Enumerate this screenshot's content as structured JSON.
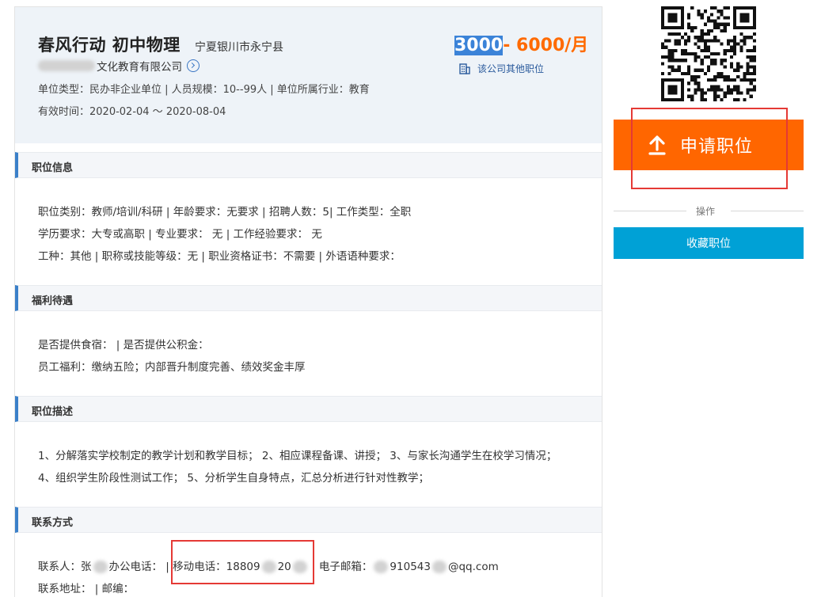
{
  "header": {
    "title": "春风行动 初中物理",
    "location": "宁夏银川市永宁县",
    "salary_selected": "3000",
    "salary_rest": "- 6000/月",
    "company_visible": "文化教育有限公司",
    "other_jobs": "该公司其他职位",
    "meta_type": "单位类型：民办非企业单位 | 人员规模：10--99人 | 单位所属行业：教育",
    "meta_date": "有效时间：2020-02-04 ～ 2020-08-04"
  },
  "sections": {
    "job_info": {
      "title": "职位信息",
      "lines": [
        "职位类别：教师/培训/科研 | 年龄要求：无要求 | 招聘人数：5| 工作类型：全职",
        "学历要求：大专或高职 | 专业要求： 无 | 工作经验要求： 无",
        "工种：其他 | 职称或技能等级：无 | 职业资格证书：不需要 | 外语语种要求："
      ]
    },
    "benefits": {
      "title": "福利待遇",
      "lines": [
        "是否提供食宿： | 是否提供公积金：",
        "员工福利：缴纳五险；内部晋升制度完善、绩效奖金丰厚"
      ]
    },
    "description": {
      "title": "职位描述",
      "lines": [
        "1、分解落实学校制定的教学计划和教学目标； 2、相应课程备课、讲授； 3、与家长沟通学生在校学习情况；",
        "4、组织学生阶段性测试工作； 5、分析学生自身特点，汇总分析进行针对性教学；"
      ]
    },
    "contact": {
      "title": "联系方式",
      "contact_label": "联系人：张",
      "office_phone": "办公电话：",
      "mobile_label": "| 移动电话：18809",
      "mobile_mid": "20",
      "email_label": "| 电子邮箱：",
      "email_mid": "910543",
      "email_suffix": "@qq.com",
      "address": "联系地址： | 邮编："
    }
  },
  "sidebar": {
    "apply_label": "申请职位",
    "operations_label": "操作",
    "favorite_label": "收藏职位"
  },
  "colors": {
    "salary": "#ff6a00",
    "apply_button": "#ff6600",
    "favorite_button": "#00a1d6",
    "section_accent": "#3b80c9",
    "highlight_box": "#e53935"
  }
}
